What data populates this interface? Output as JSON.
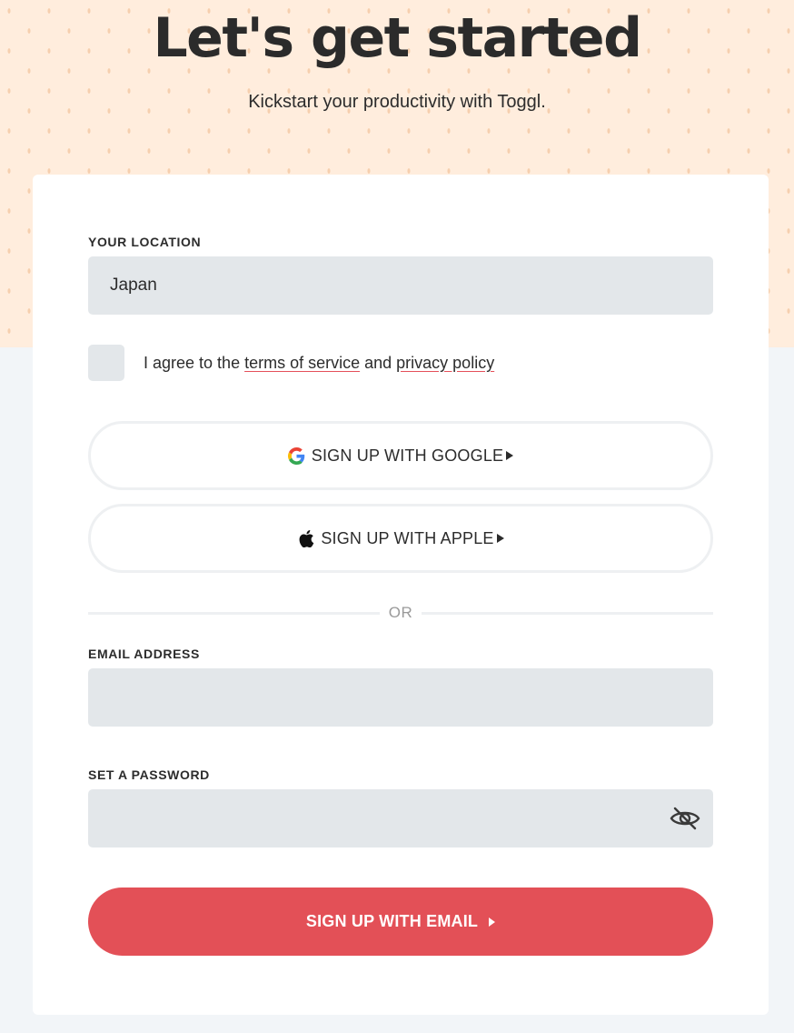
{
  "header": {
    "title": "Let's get started",
    "subtitle": "Kickstart your productivity with Toggl."
  },
  "form": {
    "location_label": "YOUR LOCATION",
    "location_value": "Japan",
    "agree_prefix": "I agree to the ",
    "terms_link": "terms of service",
    "agree_middle": " and ",
    "privacy_link": "privacy policy",
    "google_button": "SIGN UP WITH GOOGLE",
    "apple_button": "SIGN UP WITH APPLE",
    "divider_text": "OR",
    "email_label": "EMAIL ADDRESS",
    "email_value": "",
    "password_label": "SET A PASSWORD",
    "password_value": "",
    "submit_button": "SIGN UP WITH EMAIL"
  },
  "icons": {
    "google": "google-logo-icon",
    "apple": "apple-logo-icon",
    "password_visibility": "eye-slash-icon",
    "arrow": "play-arrow-icon"
  },
  "colors": {
    "hero_background": "#ffeddd",
    "page_background": "#f2f5f8",
    "field_background": "#e3e7ea",
    "accent": "#e35057"
  }
}
